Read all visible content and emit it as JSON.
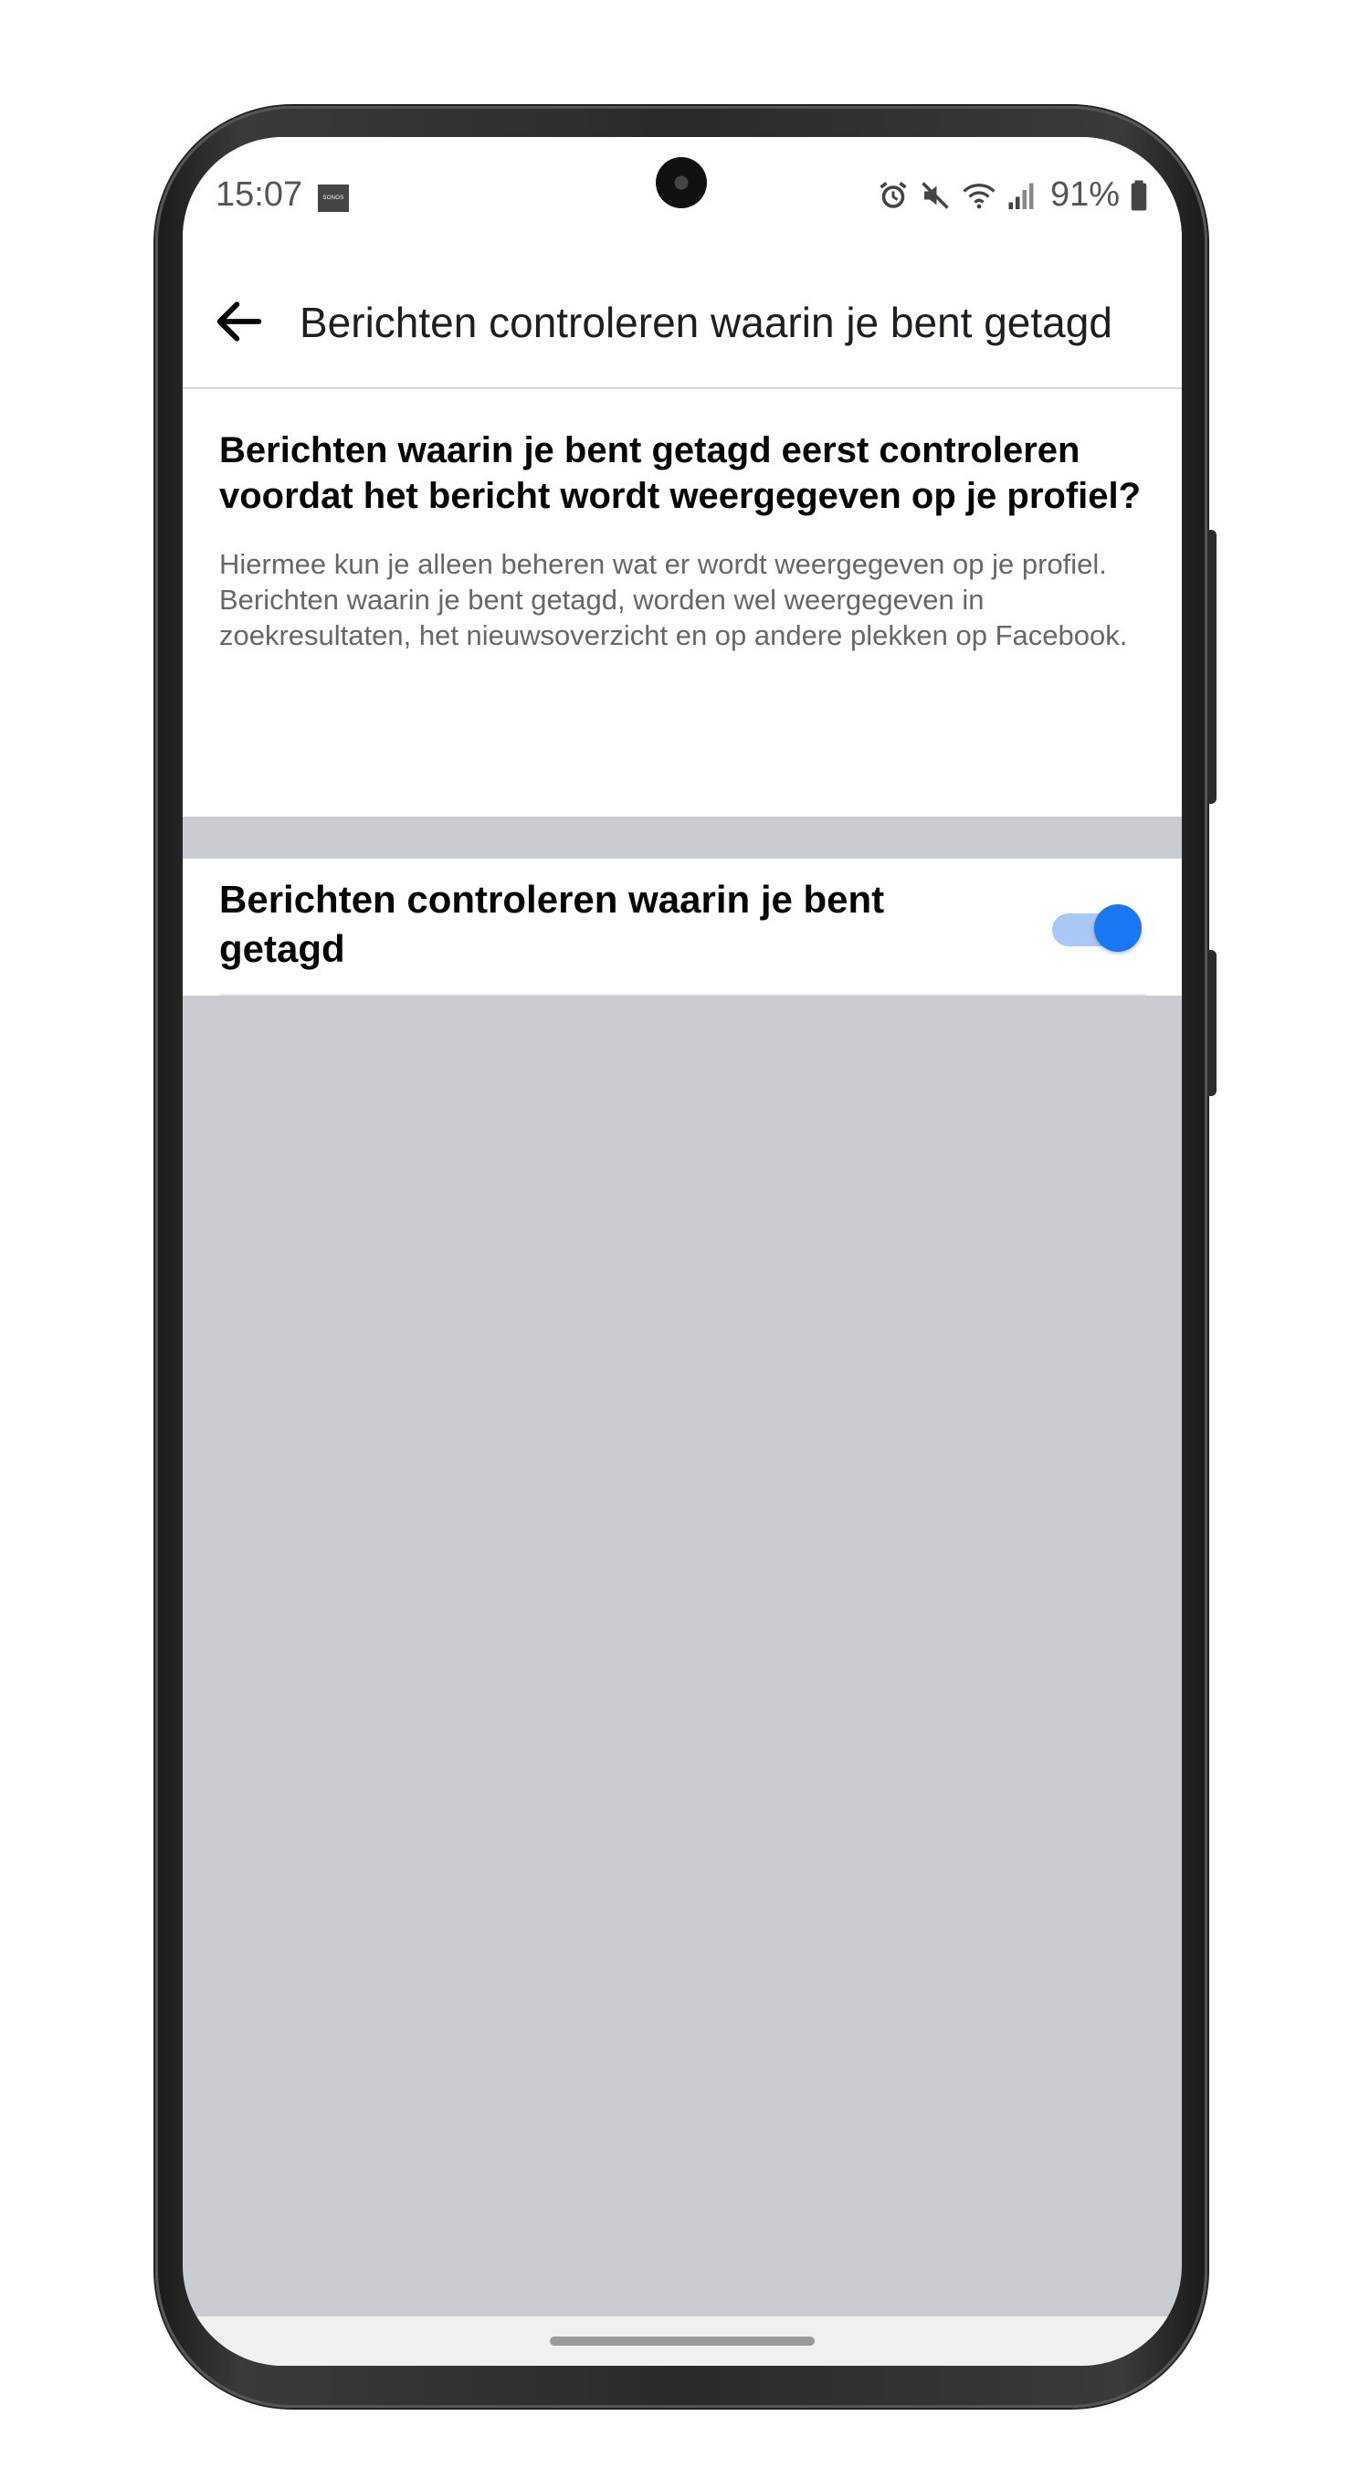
{
  "status_bar": {
    "time": "15:07",
    "sonos_label": "SONOS",
    "battery": "91%"
  },
  "header": {
    "title": "Berichten controleren waarin je bent getagd"
  },
  "info": {
    "heading": "Berichten waarin je bent getagd eerst controleren voordat het bericht wordt weergegeven op je profiel?",
    "description": "Hiermee kun je alleen beheren wat er wordt weergegeven op je profiel. Berichten waarin je bent getagd, worden wel weergegeven in zoekresultaten, het nieuwsoverzicht en op andere plekken op Facebook."
  },
  "setting": {
    "label": "Berichten controleren waarin je bent getagd",
    "enabled": true
  },
  "colors": {
    "accent": "#1877f2",
    "page_bg": "#c9ccd1"
  },
  "icons": [
    "back-arrow-icon",
    "alarm-icon",
    "mute-icon",
    "wifi-icon",
    "signal-icon",
    "battery-icon",
    "sonos-icon"
  ]
}
